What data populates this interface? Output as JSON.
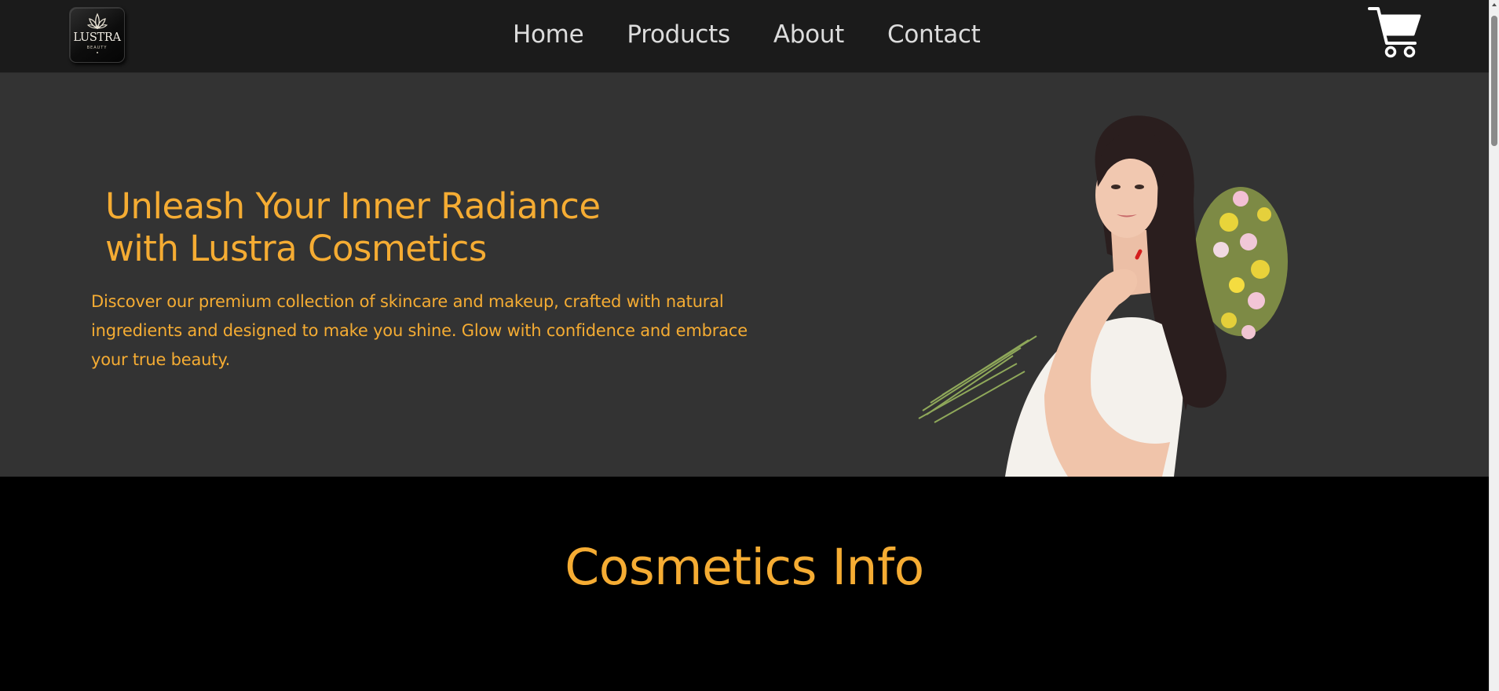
{
  "brand": {
    "logo_word": "LUSTRA",
    "logo_sub": "BEAUTY",
    "logo_icon": "lotus-icon"
  },
  "nav": {
    "items": [
      {
        "label": "Home"
      },
      {
        "label": "Products"
      },
      {
        "label": "About"
      },
      {
        "label": "Contact"
      }
    ],
    "cart_icon": "cart-icon"
  },
  "hero": {
    "title_line1": "Unleash Your Inner Radiance",
    "title_line2": "with Lustra Cosmetics",
    "text": "Discover our premium collection of skincare and makeup, crafted with natural ingredients and designed to make you shine. Glow with confidence and embrace your true beauty."
  },
  "info": {
    "title": "Cosmetics Info"
  },
  "colors": {
    "accent": "#f5ac33",
    "header_bg": "#1b1b1b",
    "hero_bg": "#333333",
    "page_bg": "#000000",
    "nav_text": "#dcdcdc"
  }
}
